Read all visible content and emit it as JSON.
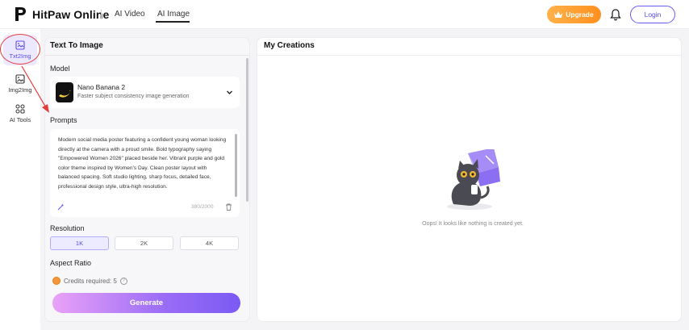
{
  "header": {
    "brand": "HitPaw Online",
    "tabs": [
      {
        "label": "AI Video"
      },
      {
        "label": "AI Image"
      }
    ],
    "active_tab": "AI Image",
    "upgrade_label": "Upgrade",
    "login_label": "Login"
  },
  "rail": {
    "items": [
      {
        "label": "Txt2Img",
        "icon": "image-text-icon"
      },
      {
        "label": "Img2Img",
        "icon": "image-icon"
      },
      {
        "label": "AI Tools",
        "icon": "grid-icon"
      }
    ],
    "active": "Txt2Img"
  },
  "left_panel": {
    "title": "Text To Image",
    "model_label": "Model",
    "model": {
      "name": "Nano Banana 2",
      "description": "Faster subject consistency image generation"
    },
    "prompts_label": "Prompts",
    "prompt_text": "Modern social media poster featuring a confident young woman looking directly at the camera with a proud smile. Bold typography saying \"Empowered Women 2026\" placed beside her. Vibrant purple and gold color theme inspired by Women's Day. Clean poster layout with balanced spacing. Soft studio lighting, sharp focus, detailed face, professional design style, ultra-high resolution.",
    "char_counter": "380/2000",
    "resolution_label": "Resolution",
    "resolutions": [
      "1K",
      "2K",
      "4K"
    ],
    "selected_resolution": "1K",
    "aspect_ratio_label": "Aspect Ratio",
    "credits_text": "Credits required: 5",
    "generate_label": "Generate"
  },
  "right_panel": {
    "title": "My Creations",
    "empty_message": "Oops! It looks like nothing is created yet."
  },
  "colors": {
    "accent": "#5a4de8",
    "upgrade": "#ff9b2e",
    "annotation": "#e23d3d"
  }
}
